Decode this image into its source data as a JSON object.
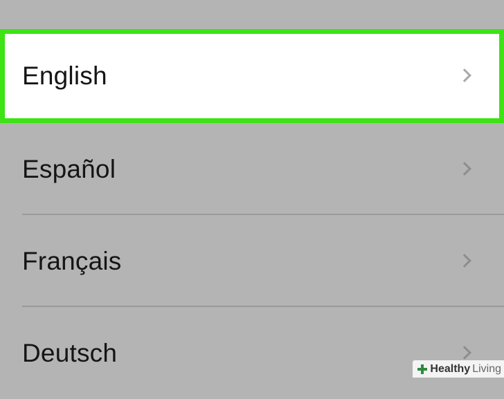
{
  "language_list": {
    "items": [
      {
        "label": "English",
        "selected": true
      },
      {
        "label": "Español",
        "selected": false
      },
      {
        "label": "Français",
        "selected": false
      },
      {
        "label": "Deutsch",
        "selected": false
      }
    ],
    "highlight_color": "#3de314",
    "row_icon": "chevron-right-icon"
  },
  "watermark": {
    "brand_bold": "Healthy",
    "brand_light": "Living",
    "icon": "plus-icon"
  }
}
